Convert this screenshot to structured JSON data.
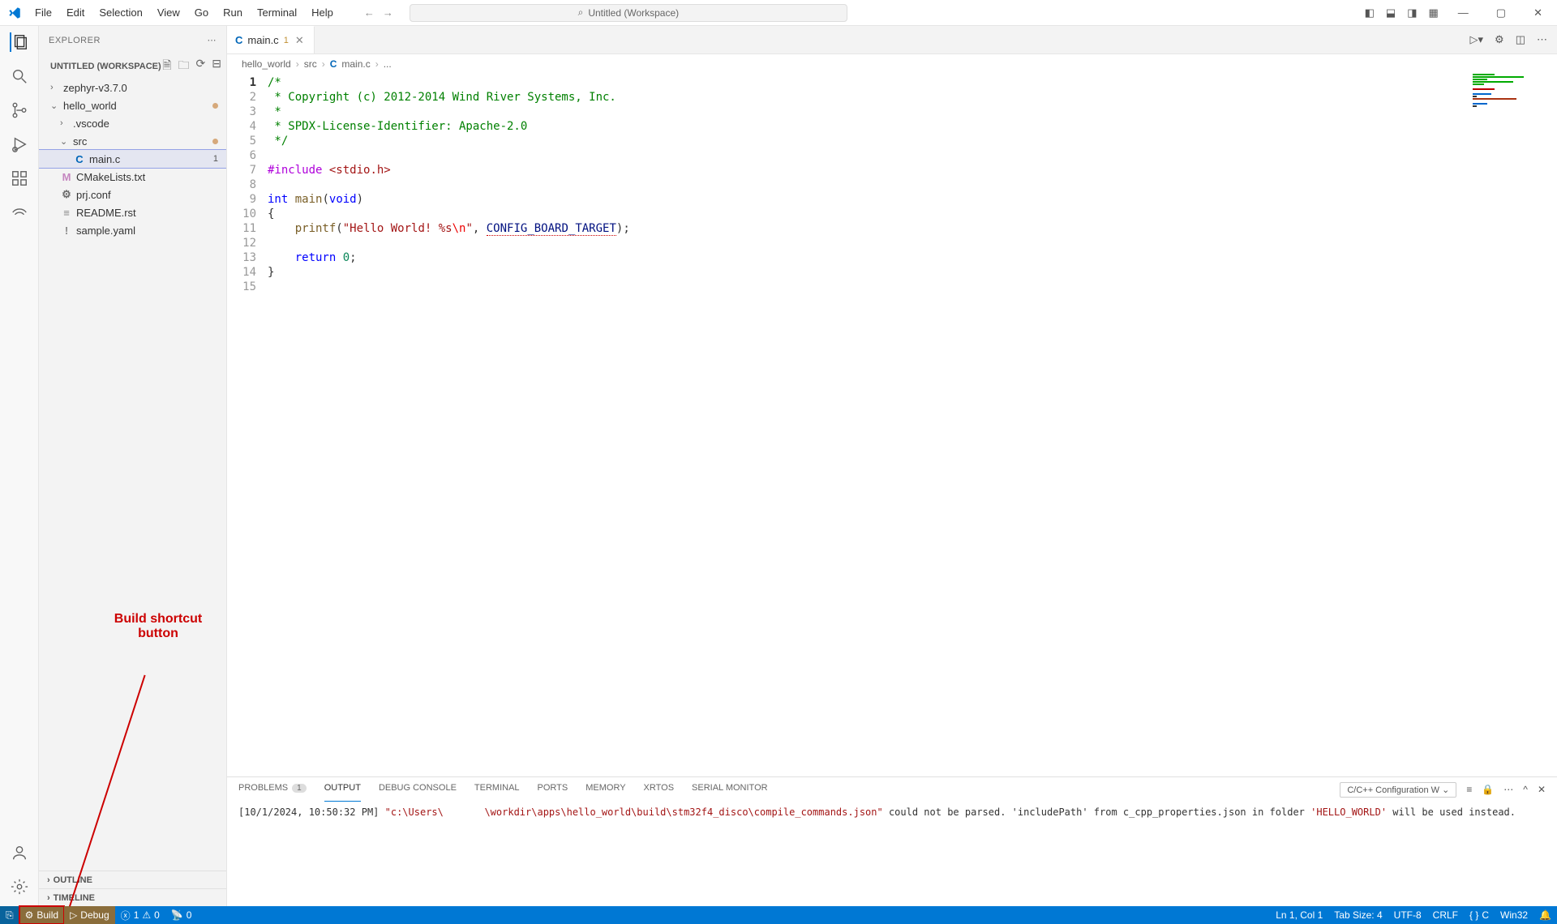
{
  "menu": {
    "file": "File",
    "edit": "Edit",
    "selection": "Selection",
    "view": "View",
    "go": "Go",
    "run": "Run",
    "terminal": "Terminal",
    "help": "Help"
  },
  "search_placeholder": "Untitled (Workspace)",
  "explorer": {
    "title": "EXPLORER",
    "workspace": "UNTITLED (WORKSPACE)",
    "items": [
      {
        "label": "zephyr-v3.7.0"
      },
      {
        "label": "hello_world"
      },
      {
        "label": ".vscode"
      },
      {
        "label": "src"
      },
      {
        "label": "main.c",
        "badge": "1"
      },
      {
        "label": "CMakeLists.txt"
      },
      {
        "label": "prj.conf"
      },
      {
        "label": "README.rst"
      },
      {
        "label": "sample.yaml"
      }
    ],
    "outline": "OUTLINE",
    "timeline": "TIMELINE"
  },
  "tab": {
    "name": "main.c",
    "modified": "1"
  },
  "breadcrumbs": {
    "p1": "hello_world",
    "p2": "src",
    "p3": "main.c",
    "p4": "..."
  },
  "code_lines": [
    "/*",
    " * Copyright (c) 2012-2014 Wind River Systems, Inc.",
    " *",
    " * SPDX-License-Identifier: Apache-2.0",
    " */",
    "",
    "#include <stdio.h>",
    "",
    "int main(void)",
    "{",
    "    printf(\"Hello World! %s\\n\", CONFIG_BOARD_TARGET);",
    "",
    "    return 0;",
    "}",
    ""
  ],
  "panel": {
    "tabs": {
      "problems": "PROBLEMS",
      "problems_count": "1",
      "output": "OUTPUT",
      "debug": "DEBUG CONSOLE",
      "terminal": "TERMINAL",
      "ports": "PORTS",
      "memory": "MEMORY",
      "xrtos": "XRTOS",
      "serial": "SERIAL MONITOR"
    },
    "dropdown": "C/C++ Configuration W",
    "text_prefix": "[10/1/2024, 10:50:32 PM] ",
    "text_path": "\"c:\\Users\\       \\workdir\\apps\\hello_world\\build\\stm32f4_disco\\compile_commands.json\"",
    "text_mid": " could not be parsed. 'includePath' from c_cpp_properties.json in folder ",
    "text_folder": "'HELLO_WORLD'",
    "text_suffix": " will be used instead."
  },
  "status": {
    "build": "Build",
    "debug": "Debug",
    "errors": "1",
    "warnings": "0",
    "ports": "0",
    "ln": "Ln 1, Col 1",
    "tab": "Tab Size: 4",
    "enc": "UTF-8",
    "eol": "CRLF",
    "lang": "C",
    "os": "Win32"
  },
  "annotation": "Build shortcut button"
}
